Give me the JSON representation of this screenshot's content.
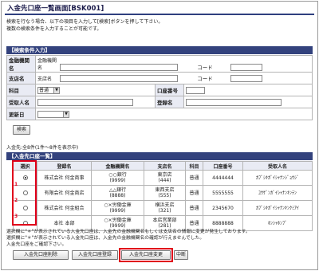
{
  "page": {
    "title": "入金先口座一覧画面[BSK001]"
  },
  "instructions": [
    "検索を行なう場合、以下の項目を入力して[検索]ボタンを押して下さい。",
    "複数の検索条件を入力することが可能です。"
  ],
  "search": {
    "header": "【検索条件入力】",
    "bank_label": "金融機関名",
    "bank_sub": "金融機関名",
    "bank_code_label": "コード",
    "branch_label": "支店名",
    "branch_sub": "支店名",
    "branch_code_label": "コード",
    "subject_label": "科目",
    "subject_value": "普通",
    "account_no_label": "口座番号",
    "recipient_label": "受取人名",
    "registered_label": "登録名",
    "updated_label": "更新日",
    "search_button": "検索"
  },
  "result_count": "入金先:全8件(1件～8件を表示中)",
  "results": {
    "header": "【入金先口座一覧】",
    "columns": [
      "選択",
      "登録名",
      "金融機関名",
      "支店名",
      "科目",
      "口座番号",
      "受取人名"
    ],
    "rows": [
      {
        "reg": "株式会社 何金商事",
        "bank": "○○銀行",
        "bank_code": "(9999)",
        "branch": "東京店",
        "branch_code": "(444)",
        "type": "普通",
        "acct": "4444444",
        "payee": "ｶﾌﾞｼｷｶﾞｲｼｬﾅﾝｼﾞｮｳｼﾞ",
        "selected": true
      },
      {
        "reg": "有限会社 何金商店",
        "bank": "△△銀行",
        "bank_code": "(8888)",
        "branch": "東西支店",
        "branch_code": "(555)",
        "type": "普通",
        "acct": "5555555",
        "payee": "ﾕｳｹﾞﾝｶﾞｲｼｬﾅﾝｷﾝﾃﾝ",
        "selected": false
      },
      {
        "reg": "株式会社 何金組合",
        "bank": "○×労働金庫",
        "bank_code": "(9999)",
        "branch": "横浜支店",
        "branch_code": "(321)",
        "type": "普通",
        "acct": "2345670",
        "payee": "ｶﾌﾞｼｷｶﾞｲｼｬﾅﾝｷﾝｸﾐｱｲ",
        "selected": false
      },
      {
        "reg": "本社 本部",
        "bank": "○×労働金庫",
        "bank_code": "(9999)",
        "branch": "本店営業部",
        "branch_code": "(281)",
        "type": "普通",
        "acct": "8888888",
        "payee": "ﾎﾝｼｬﾎﾝﾌﾞ",
        "selected": false
      }
    ],
    "row_marks": [
      "1",
      "2",
      "3"
    ]
  },
  "notes": [
    "選択欄に\"＊\"が表示されている入金先口座は、入金先の金融機関名もしくは支店名の情報に変更が発生しております。",
    "選択欄に\"＊\"が表示されている入金先口座は、入金先の金融機関名の確認が行えませんでした。",
    "入金先口座をご確認下さい。"
  ],
  "buttons": {
    "delete": "入金先口座削除",
    "register": "入金先口座登録",
    "change": "入金先口座変更",
    "cancel": "中断"
  },
  "colors": {
    "header_bg": "#33427d",
    "highlight": "#e0001a",
    "label_bg": "#e9ebf4"
  }
}
